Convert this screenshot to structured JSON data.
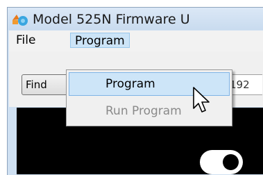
{
  "window": {
    "title": "Model 525N Firmware U"
  },
  "menubar": {
    "file_label": "File",
    "program_label": "Program"
  },
  "toolbar": {
    "find_label": "Find",
    "ip_value": "192"
  },
  "program_menu": {
    "items": [
      {
        "label": "Program",
        "enabled": true,
        "highlighted": true
      },
      {
        "label": "Run Program",
        "enabled": false,
        "highlighted": false
      }
    ]
  },
  "icons": {
    "app": "app-icon",
    "cursor": "mouse-pointer-icon",
    "toggle": "toggle-switch-icon"
  },
  "colors": {
    "menu_highlight": "#cde5f8",
    "disabled_text": "#8a8a8a",
    "panel": "#000000"
  }
}
